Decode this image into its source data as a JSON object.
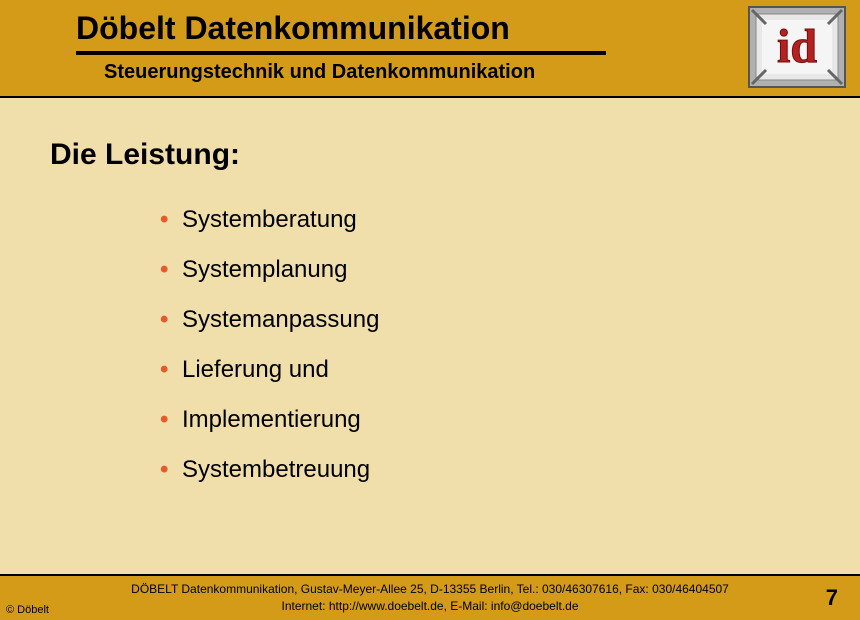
{
  "header": {
    "title": "Döbelt Datenkommunikation",
    "subtitle": "Steuerungstechnik und Datenkommunikation"
  },
  "content": {
    "heading": "Die Leistung:",
    "bullets": [
      "Systemberatung",
      "Systemplanung",
      "Systemanpassung",
      "Lieferung und",
      "Implementierung",
      "Systembetreuung"
    ]
  },
  "footer": {
    "copyright": "© Döbelt",
    "line1": "DÖBELT Datenkommunikation, Gustav-Meyer-Allee 25, D-13355 Berlin, Tel.: 030/46307616, Fax: 030/46404507",
    "line2": "Internet: http://www.doebelt.de, E-Mail: info@doebelt.de",
    "page": "7"
  }
}
